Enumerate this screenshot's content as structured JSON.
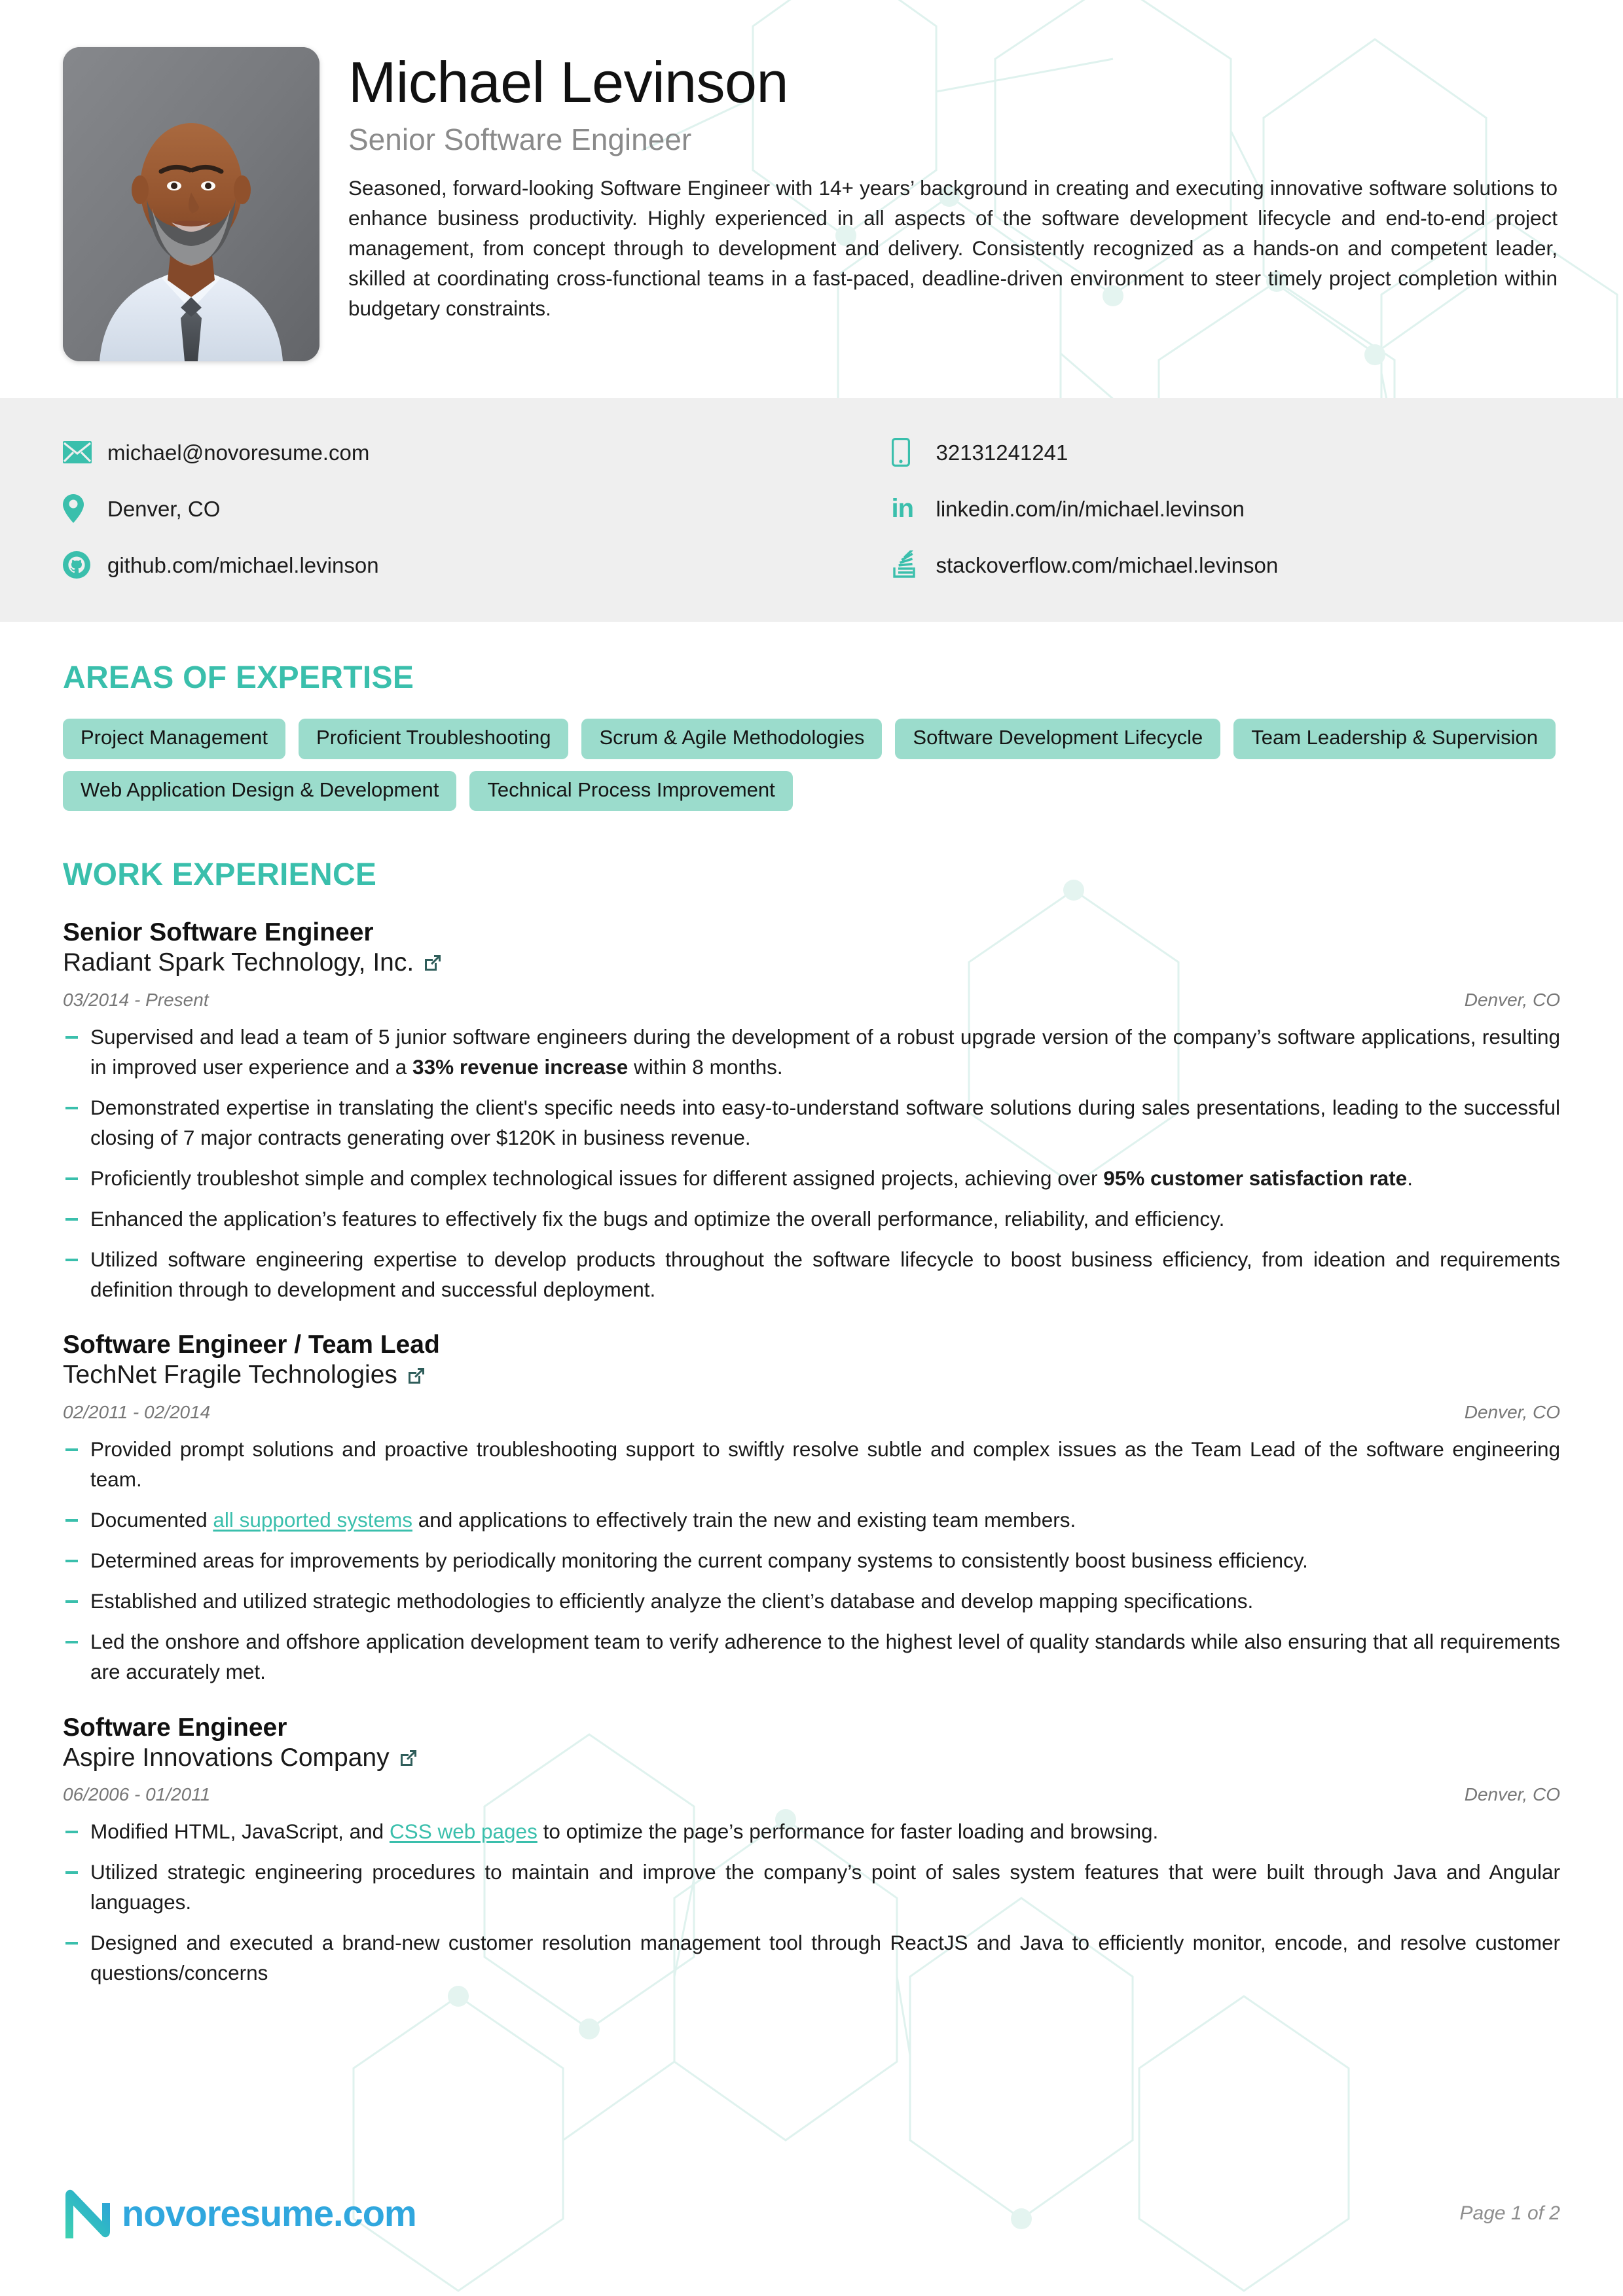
{
  "colors": {
    "accent_teal": "#3ABFAC",
    "skill_tag_bg": "#9BDCCC",
    "contact_band_bg": "#EFEFEF",
    "link_icon": "#2F5D5A",
    "logo_blue": "#30A7DE",
    "muted_text": "#8B8B8B"
  },
  "header": {
    "full_name": "Michael Levinson",
    "job_title": "Senior Software Engineer",
    "summary": "Seasoned, forward-looking Software Engineer with 14+ years’ background in creating and executing innovative software solutions to enhance business productivity. Highly experienced in all aspects of the software development lifecycle and end-to-end project management, from concept through to development and delivery. Consistently recognized as a hands-on and competent leader, skilled at coordinating cross-functional teams in a fast-paced, deadline-driven environment to steer timely project completion within budgetary constraints.",
    "photo_alt": "portrait-photo"
  },
  "contact": {
    "left": [
      {
        "icon": "envelope-icon",
        "value": "michael@novoresume.com"
      },
      {
        "icon": "map-pin-icon",
        "value": "Denver, CO"
      },
      {
        "icon": "github-icon",
        "value": "github.com/michael.levinson"
      }
    ],
    "right": [
      {
        "icon": "mobile-phone-icon",
        "value": "32131241241"
      },
      {
        "icon": "linkedin-icon",
        "value": "linkedin.com/in/michael.levinson"
      },
      {
        "icon": "stackoverflow-icon",
        "value": "stackoverflow.com/michael.levinson"
      }
    ]
  },
  "expertise": {
    "title": "AREAS OF EXPERTISE",
    "skills": [
      "Project Management",
      "Proficient Troubleshooting",
      "Scrum & Agile Methodologies",
      "Software Development Lifecycle",
      "Team Leadership & Supervision",
      "Web Application Design & Development",
      "Technical Process Improvement"
    ]
  },
  "work": {
    "title": "WORK EXPERIENCE",
    "jobs": [
      {
        "role": "Senior Software Engineer",
        "company": "Radiant Spark Technology, Inc.",
        "dates": "03/2014 - Present",
        "location": "Denver, CO",
        "bullets": [
          "Supervised and lead a team of 5 junior software engineers during the development of a robust upgrade version of the company’s software applications, resulting in improved user experience and a <b>33% revenue increase</b> within 8 months.",
          "Demonstrated expertise in translating the client's specific needs into easy-to-understand software solutions during sales presentations, leading to the successful closing of 7 major contracts generating over $120K in business revenue.",
          "Proficiently troubleshot simple and complex technological issues for different assigned projects, achieving over <b>95% customer satisfaction rate</b>.",
          "Enhanced the application’s features to effectively fix the bugs and optimize the overall performance, reliability, and efficiency.",
          "Utilized software engineering expertise to develop products throughout the software lifecycle to boost business efficiency, from ideation and requirements definition through to development and successful deployment."
        ]
      },
      {
        "role": "Software Engineer / Team Lead",
        "company": "TechNet Fragile Technologies",
        "dates": "02/2011 - 02/2014",
        "location": "Denver, CO",
        "bullets": [
          "Provided prompt solutions and proactive troubleshooting support to swiftly resolve subtle and complex issues as the Team Lead of the software engineering team.",
          "Documented <a class=\"inline-link\" data-name=\"inline-link-all-supported-systems\" data-interactable=\"true\">all supported systems</a> and applications to effectively train the new and existing team members.",
          "Determined areas for improvements by periodically monitoring the current company systems to consistently boost business efficiency.",
          "Established and utilized strategic methodologies to efficiently analyze the client’s database and develop mapping specifications.",
          "Led the onshore and offshore application development team to verify adherence to the highest level of quality standards while also ensuring that all requirements are accurately met."
        ]
      },
      {
        "role": "Software Engineer",
        "company": "Aspire Innovations Company",
        "dates": "06/2006 - 01/2011",
        "location": "Denver, CO",
        "bullets": [
          "Modified HTML, JavaScript, and <a class=\"inline-link\" data-name=\"inline-link-css-web-pages\" data-interactable=\"true\">CSS web pages</a> to optimize the page’s performance for faster loading and browsing.",
          "Utilized strategic engineering procedures to maintain and improve the company’s point of sales system features that were built through Java and Angular languages.",
          "Designed and executed a brand-new customer resolution management tool through ReactJS and Java to efficiently monitor, encode, and resolve customer questions/concerns"
        ]
      }
    ]
  },
  "footer": {
    "logo_text": "novoresume.com",
    "page_number": "Page 1 of 2"
  }
}
